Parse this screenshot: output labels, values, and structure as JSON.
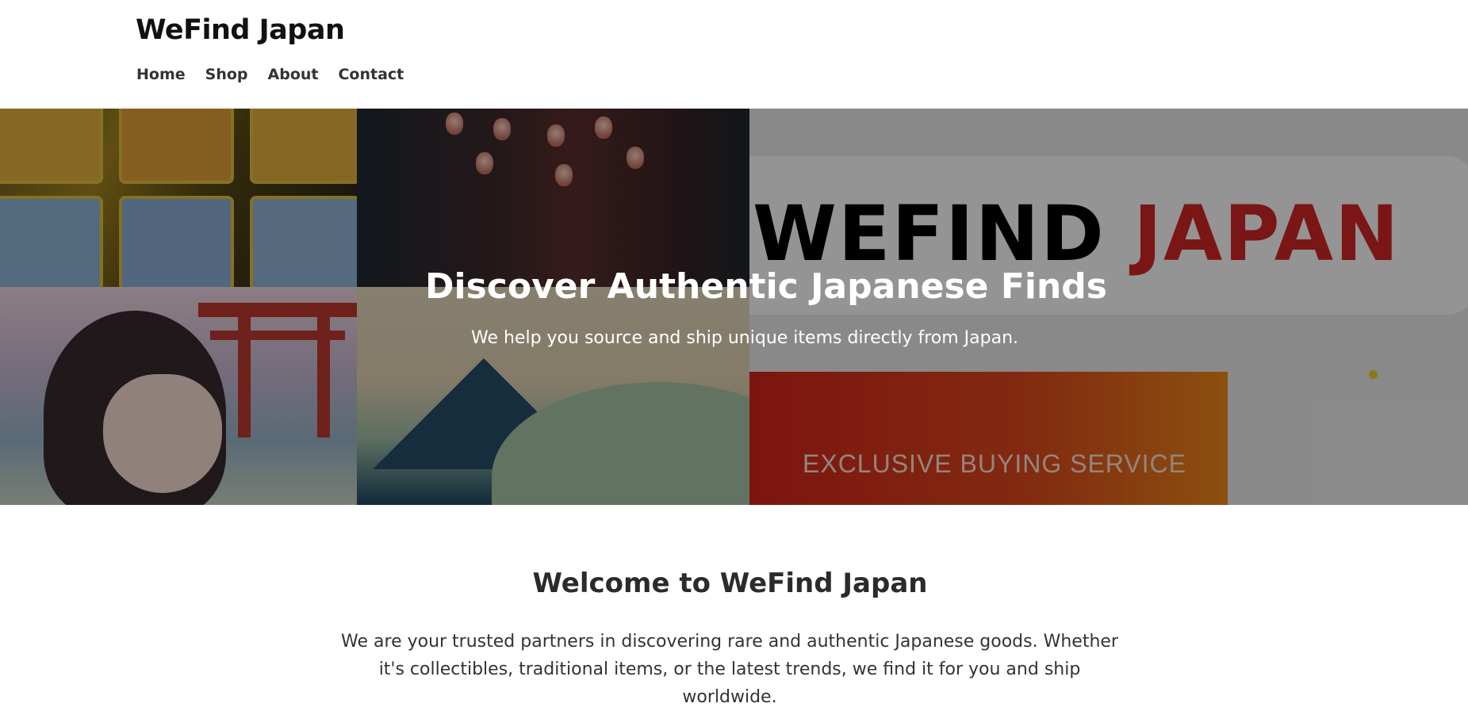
{
  "header": {
    "site_title": "WeFind Japan",
    "nav": [
      {
        "label": "Home"
      },
      {
        "label": "Shop"
      },
      {
        "label": "About"
      },
      {
        "label": "Contact"
      }
    ]
  },
  "hero": {
    "title": "Discover Authentic Japanese Finds",
    "subtitle": "We help you source and ship unique items directly from Japan.",
    "logo_word_1": "WEFIND",
    "logo_word_2": "JAPAN",
    "banner_text": "EXCLUSIVE BUYING SERVICE"
  },
  "welcome": {
    "title": "Welcome to WeFind Japan",
    "text": "We are your trusted partners in discovering rare and authentic Japanese goods. Whether it's collectibles, traditional items, or the latest trends, we find it for you and ship worldwide."
  },
  "colors": {
    "logo_red": "#d42727",
    "banner_orange": "#e04c1c"
  }
}
